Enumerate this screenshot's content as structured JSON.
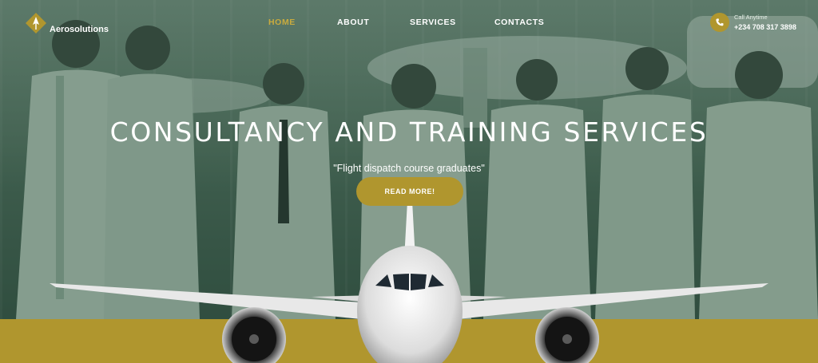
{
  "brand": {
    "name": "Aerosolutions"
  },
  "nav": {
    "items": [
      {
        "label": "HOME",
        "active": true
      },
      {
        "label": "ABOUT",
        "active": false
      },
      {
        "label": "SERVICES",
        "active": false
      },
      {
        "label": "CONTACTS",
        "active": false
      }
    ]
  },
  "contact": {
    "label": "Call Anytime",
    "phone": "+234 708 317 3898",
    "icon": "phone-icon"
  },
  "hero": {
    "title": "CONSULTANCY AND TRAINING SERVICES",
    "subtitle": "\"Flight dispatch course graduates\"",
    "cta_label": "READ MORE!"
  },
  "colors": {
    "accent": "#b0962e",
    "nav_active": "#c9ab3e",
    "overlay": "#4d6e5c",
    "text": "#ffffff"
  }
}
